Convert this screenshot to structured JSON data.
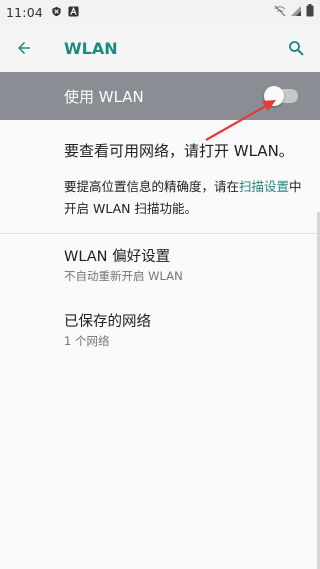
{
  "status_bar": {
    "time": "11:04",
    "icons": [
      "shield-icon",
      "a-notification-icon",
      "wifi-off-icon",
      "signal-icon",
      "battery-icon"
    ]
  },
  "app_bar": {
    "title": "WLAN",
    "back_icon": "arrow-back-icon",
    "search_icon": "search-icon",
    "accent_color": "#1c8a80"
  },
  "master_switch": {
    "label": "使用 WLAN",
    "enabled": false,
    "background_color": "#8a8e94"
  },
  "empty_state": {
    "message": "要查看可用网络，请打开 WLAN。",
    "hint_before": "要提高位置信息的精确度，请在",
    "hint_link": "扫描设置",
    "hint_after": "中开启 WLAN 扫描功能。"
  },
  "preferences": [
    {
      "title": "WLAN 偏好设置",
      "summary": "不自动重新开启 WLAN"
    },
    {
      "title": "已保存的网络",
      "summary": "1 个网络"
    }
  ],
  "annotation": {
    "color": "#e53935"
  }
}
